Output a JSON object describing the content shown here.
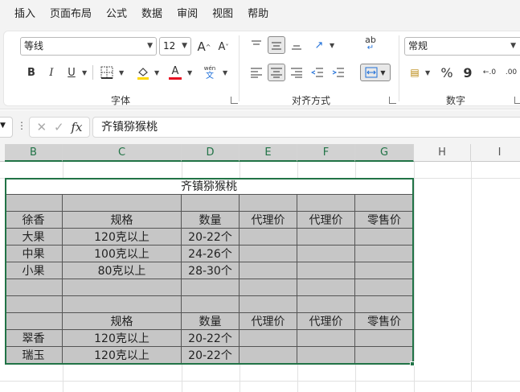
{
  "menu": [
    "插入",
    "页面布局",
    "公式",
    "数据",
    "审阅",
    "视图",
    "帮助"
  ],
  "ribbon": {
    "font_name": "等线",
    "font_size": "12",
    "grow_font": "A",
    "shrink_font": "A",
    "bold": "B",
    "italic": "I",
    "underline": "U",
    "font_color_glyph": "A",
    "phonetic_top": "wén",
    "phonetic_bottom": "文",
    "wrap_glyph": "ab",
    "font_group_label": "字体",
    "align_group_label": "对齐方式",
    "number_format": "常规",
    "percent": "%",
    "comma": "9",
    "inc_decimal": "←.0",
    "dec_decimal": ".00",
    "number_group_label": "数字",
    "fill_color": "#ffd800",
    "font_color": "#e81123"
  },
  "formula_bar": {
    "fx": "fx",
    "value": "齐镇猕猴桃"
  },
  "columns": [
    "B",
    "C",
    "D",
    "E",
    "F",
    "G",
    "H",
    "I"
  ],
  "table": {
    "title": "齐镇猕猴桃",
    "header1": [
      "徐香",
      "规格",
      "数量",
      "代理价",
      "代理价",
      "零售价"
    ],
    "rows1": [
      [
        "大果",
        "120克以上",
        "20-22个",
        "",
        "",
        ""
      ],
      [
        "中果",
        "100克以上",
        "24-26个",
        "",
        "",
        ""
      ],
      [
        "小果",
        "80克以上",
        "28-30个",
        "",
        "",
        ""
      ]
    ],
    "header2": [
      "",
      "规格",
      "数量",
      "代理价",
      "代理价",
      "零售价"
    ],
    "rows2": [
      [
        "翠香",
        "120克以上",
        "20-22个",
        "",
        "",
        ""
      ],
      [
        "瑞玉",
        "120克以上",
        "20-22个",
        "",
        "",
        ""
      ]
    ]
  },
  "colors": {
    "selection": "#217346",
    "table_fill": "#c6c6c6"
  }
}
